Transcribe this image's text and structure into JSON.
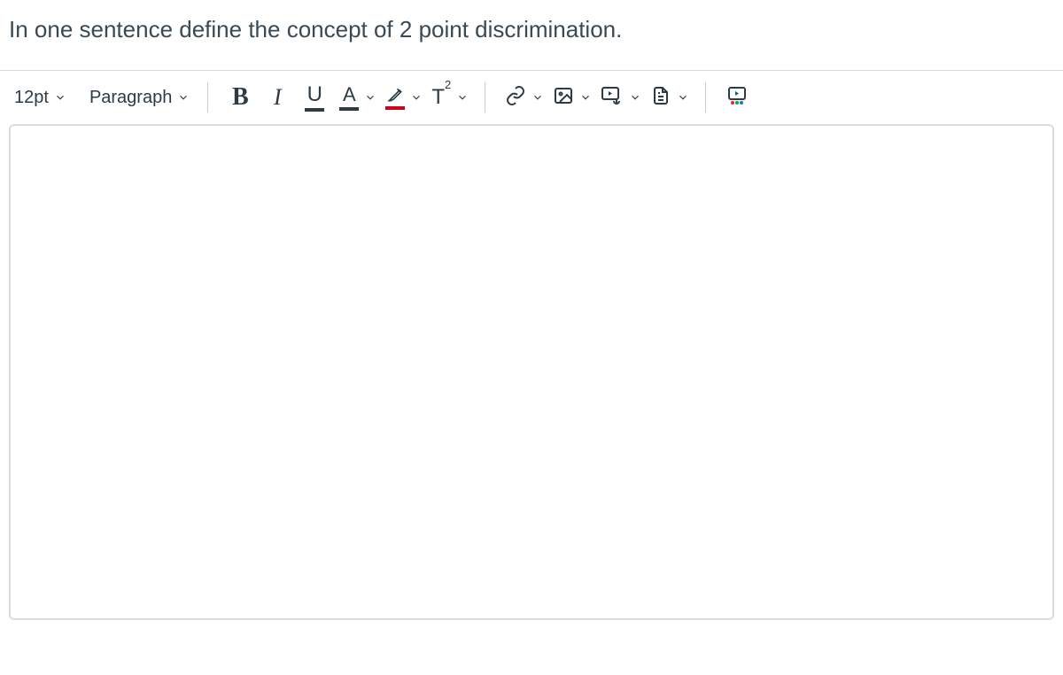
{
  "question": "In one sentence define the concept of 2 point discrimination.",
  "toolbar": {
    "fontSize": "12pt",
    "blockFormat": "Paragraph"
  },
  "editor": {
    "content": ""
  },
  "icons": {
    "bold": "B",
    "italic": "I",
    "underline": "U",
    "textcolor": "A",
    "superscript": "T",
    "superscript_exp": "2"
  }
}
